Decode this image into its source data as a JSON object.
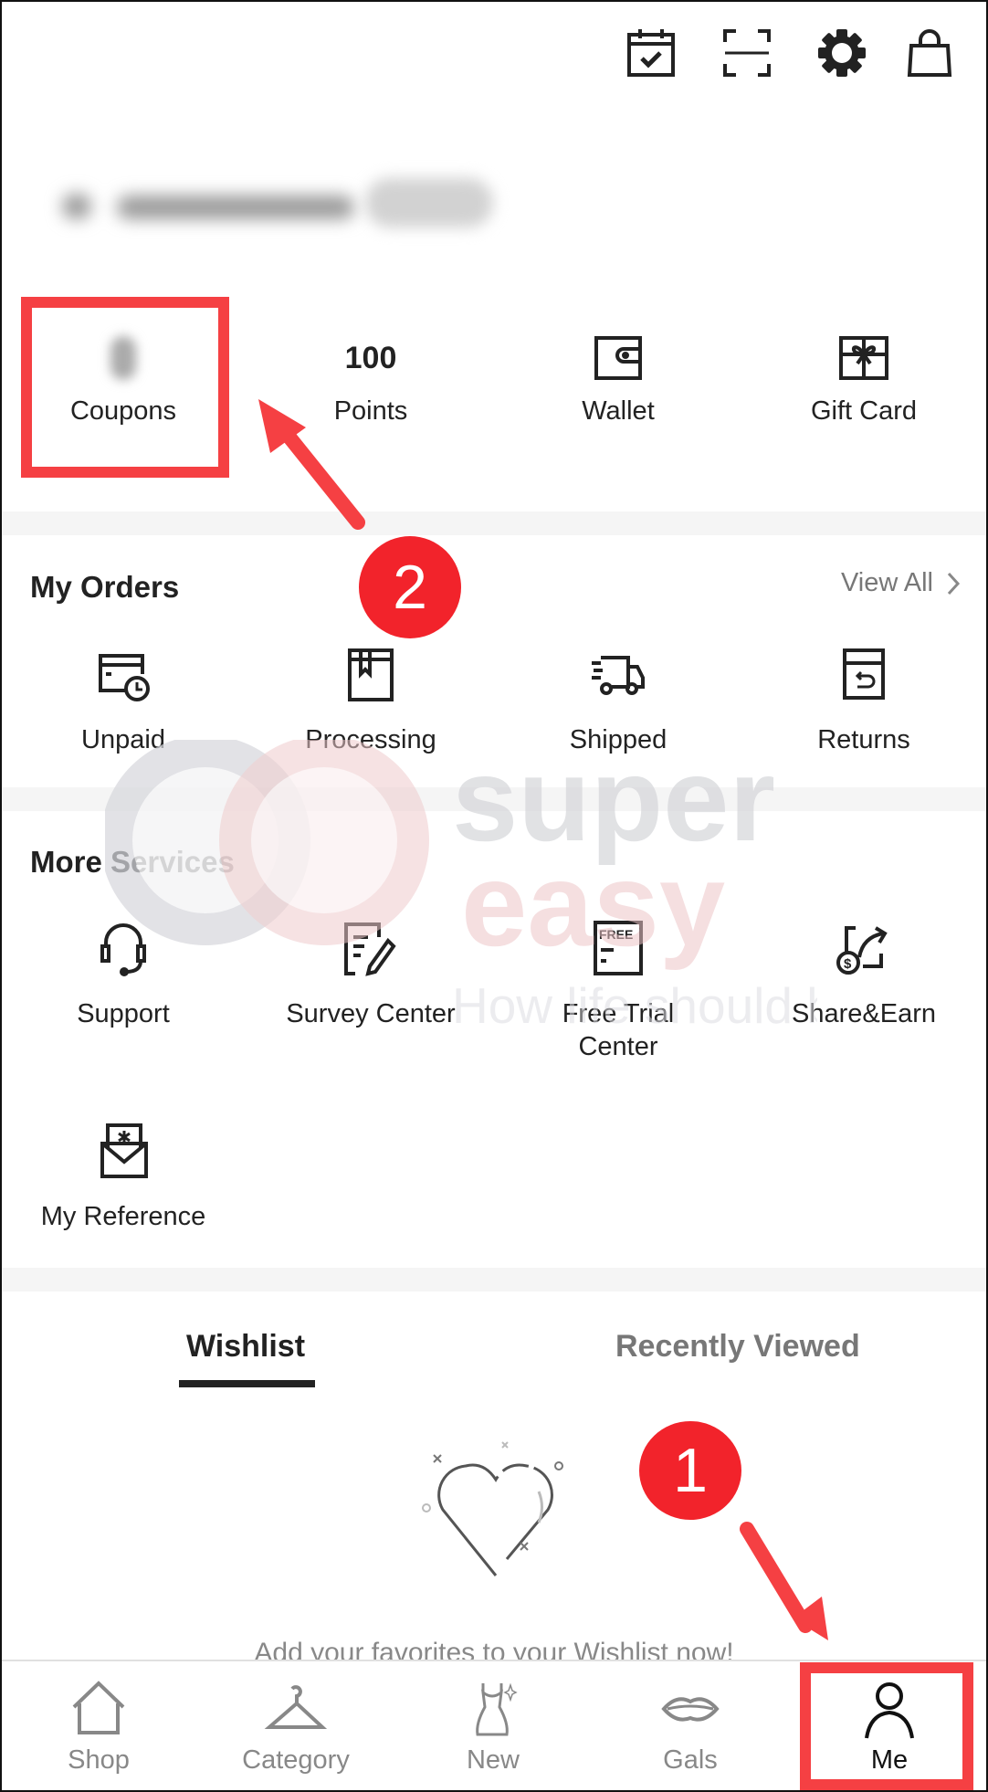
{
  "header": {
    "icons": [
      {
        "name": "check-in-calendar-icon"
      },
      {
        "name": "scan-icon"
      },
      {
        "name": "settings-gear-icon"
      },
      {
        "name": "shopping-bag-icon"
      }
    ],
    "greeting_blurred": true
  },
  "stats": [
    {
      "value": "",
      "label": "Coupons",
      "blurred": true
    },
    {
      "value": "100",
      "label": "Points"
    },
    {
      "value": "",
      "label": "Wallet",
      "icon": "wallet-icon"
    },
    {
      "value": "",
      "label": "Gift Card",
      "icon": "gift-card-icon"
    }
  ],
  "orders": {
    "title": "My Orders",
    "view_all": "View All",
    "items": [
      {
        "label": "Unpaid",
        "icon": "unpaid-card-clock-icon"
      },
      {
        "label": "Processing",
        "icon": "processing-box-icon"
      },
      {
        "label": "Shipped",
        "icon": "shipped-truck-icon"
      },
      {
        "label": "Returns",
        "icon": "returns-box-icon"
      }
    ]
  },
  "services": {
    "title": "More Services",
    "items": [
      {
        "label": "Support",
        "icon": "headset-icon"
      },
      {
        "label": "Survey Center",
        "icon": "survey-pencil-icon"
      },
      {
        "label": "Free Trial Center",
        "icon": "free-trial-icon",
        "icon_text": "FREE"
      },
      {
        "label": "Share&Earn",
        "icon": "share-earn-icon"
      },
      {
        "label": "My Reference",
        "icon": "reference-envelope-icon"
      }
    ]
  },
  "tabs": [
    {
      "label": "Wishlist",
      "active": true
    },
    {
      "label": "Recently Viewed",
      "active": false
    }
  ],
  "wishlist_empty_text": "Add your favorites to your Wishlist now!",
  "bottom_nav": [
    {
      "label": "Shop",
      "icon": "home-icon",
      "active": false
    },
    {
      "label": "Category",
      "icon": "hanger-icon",
      "active": false
    },
    {
      "label": "New",
      "icon": "dress-icon",
      "active": false
    },
    {
      "label": "Gals",
      "icon": "lips-icon",
      "active": false
    },
    {
      "label": "Me",
      "icon": "person-icon",
      "active": true
    }
  ],
  "annotations": {
    "step1": "1",
    "step2": "2",
    "highlight_color": "#f54043",
    "badge_color": "#f2232b"
  },
  "watermark": {
    "line1": "super",
    "line2": "easy",
    "tagline": "How life should be"
  }
}
